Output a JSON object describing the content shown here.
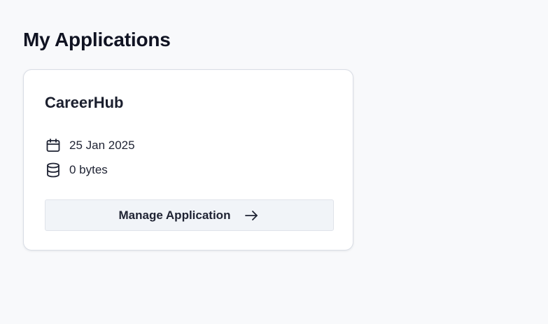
{
  "page": {
    "title": "My Applications"
  },
  "applications": [
    {
      "name": "CareerHub",
      "date": "25 Jan 2025",
      "date_icon": "calendar-icon",
      "storage": "0 bytes",
      "storage_icon": "database-icon",
      "action_label": "Manage Application",
      "action_icon": "arrow-right-icon"
    }
  ],
  "colors": {
    "background": "#f8f9fb",
    "card": "#ffffff",
    "card_border": "#d9dde5",
    "button_background": "#f1f4f8",
    "text": "#1b1f2e"
  }
}
